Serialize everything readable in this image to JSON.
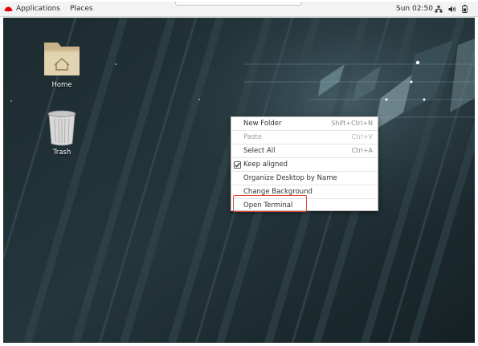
{
  "topbar": {
    "applications_label": "Applications",
    "places_label": "Places",
    "clock": "Sun 02:50",
    "tray_icons": [
      "network-icon",
      "volume-icon",
      "battery-icon"
    ]
  },
  "desktop": {
    "icons": [
      {
        "label": "Home",
        "icon": "home-folder-icon"
      },
      {
        "label": "Trash",
        "icon": "trash-icon"
      }
    ]
  },
  "context_menu": {
    "items": [
      {
        "label": "New Folder",
        "accelerator": "Shift+Ctrl+N",
        "enabled": true
      },
      {
        "label": "Paste",
        "accelerator": "Ctrl+V",
        "enabled": false
      },
      {
        "label": "Select All",
        "accelerator": "Ctrl+A",
        "enabled": true
      },
      {
        "label": "Keep aligned",
        "accelerator": "",
        "enabled": true,
        "checked": true
      },
      {
        "label": "Organize Desktop by Name",
        "accelerator": "",
        "enabled": true
      },
      {
        "label": "Change Background",
        "accelerator": "",
        "enabled": true
      },
      {
        "label": "Open Terminal",
        "accelerator": "",
        "enabled": true,
        "highlighted": true
      }
    ]
  },
  "colors": {
    "highlight_border": "#e3432c",
    "redhat_red": "#ee0000",
    "desktop_bg": "#1f2d32"
  }
}
